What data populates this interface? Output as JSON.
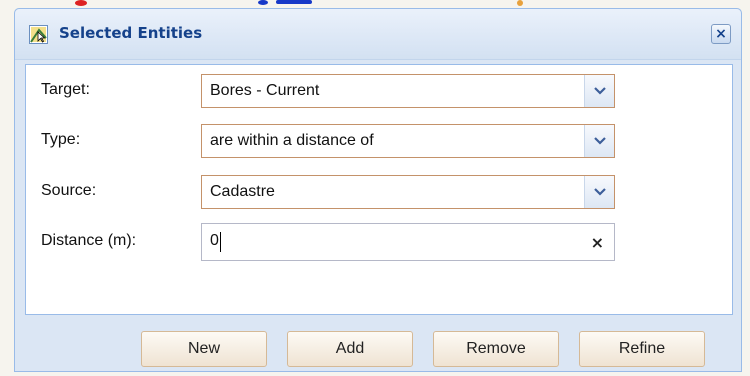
{
  "dialog": {
    "title": "Selected Entities",
    "close_label": "×"
  },
  "form": {
    "target": {
      "label": "Target:",
      "value": "Bores - Current"
    },
    "type": {
      "label": "Type:",
      "value": "are within a distance of"
    },
    "source": {
      "label": "Source:",
      "value": "Cadastre"
    },
    "distance": {
      "label": "Distance (m):",
      "value": "0",
      "clear": "×"
    }
  },
  "buttons": {
    "new": "New",
    "add": "Add",
    "remove": "Remove",
    "refine": "Refine"
  },
  "icons": {
    "title": "map-select-icon",
    "close": "close-icon",
    "dropdown": "chevron-down-icon",
    "clear": "clear-icon"
  },
  "colors": {
    "title_text": "#15428b",
    "window_border": "#99bbe8",
    "button_fill": "#efe3d2"
  }
}
